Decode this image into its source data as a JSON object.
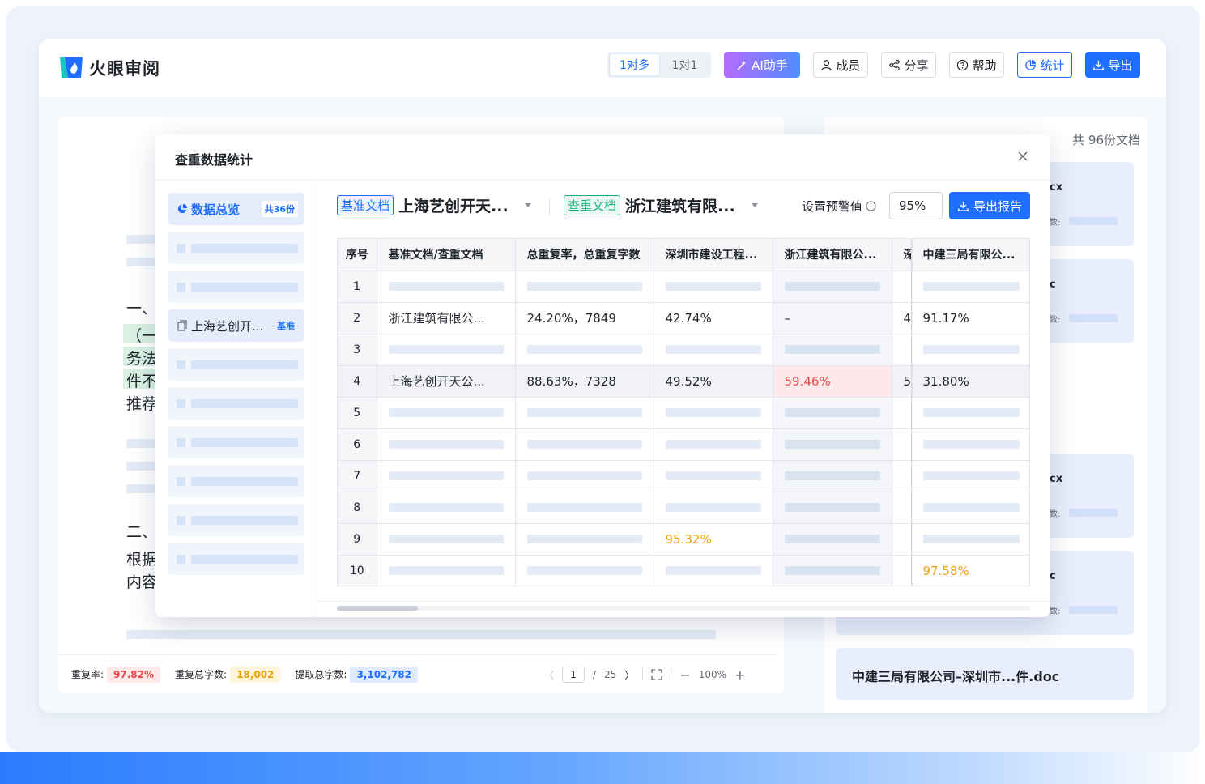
{
  "app": {
    "logo_text": "火眼审阅"
  },
  "header": {
    "mode_toggle": [
      "1对多",
      "1对1"
    ],
    "ai_label": "AI助手",
    "members_label": "成员",
    "share_label": "分享",
    "help_label": "帮助",
    "stats_label": "统计",
    "export_label": "导出"
  },
  "doc": {
    "section1": "一、",
    "para1_lines": [
      "（一",
      "务法",
      "件不",
      "推荐"
    ],
    "section2": "二、",
    "para2_lines": [
      "根据",
      "内容"
    ]
  },
  "footer": {
    "rate_label": "重复率:",
    "rate_value": "97.82%",
    "dup_label": "重复总字数:",
    "dup_value": "18,002",
    "total_label": "提取总字数:",
    "total_value": "3,102,782",
    "page_current": "1",
    "page_sep": "/",
    "page_total": "25",
    "zoom": "100%"
  },
  "right_panel": {
    "count_text": "共 96份文档",
    "card_suffix": "cx",
    "card_sub": "数:",
    "card_suffix_b": "c",
    "last_card_title": "中建三局有限公司–深圳市...件.doc"
  },
  "modal": {
    "title": "查重数据统计",
    "sidebar": {
      "overview_label": "数据总览",
      "overview_badge": "共36份",
      "doc_label": "上海艺创开...",
      "doc_badge": "基准"
    },
    "base_tag": "基准文档",
    "base_name": "上海艺创开天...",
    "cmp_tag": "查重文档",
    "cmp_name": "浙江建筑有限...",
    "warn_label": "设置预警值",
    "warn_value": "95%",
    "report_btn": "导出报告",
    "table": {
      "headers": [
        "序号",
        "基准文档/查重文档",
        "总重复率，总重复字数",
        "深圳市建设工程...",
        "浙江建筑有限公...",
        "深",
        "中建三局有限公..."
      ],
      "rows": [
        {
          "idx": "1"
        },
        {
          "idx": "2",
          "name": "浙江建筑有限公...",
          "total": "24.20%，7849",
          "c1": "42.74%",
          "c2": "–",
          "c3": "4",
          "c4": "91.17%"
        },
        {
          "idx": "3"
        },
        {
          "idx": "4",
          "name": "上海艺创开天公...",
          "total": "88.63%，7328",
          "c1": "49.52%",
          "c2": "59.46%",
          "c3": "5",
          "c4": "31.80%"
        },
        {
          "idx": "5"
        },
        {
          "idx": "6"
        },
        {
          "idx": "7"
        },
        {
          "idx": "8"
        },
        {
          "idx": "9",
          "c1": "95.32%"
        },
        {
          "idx": "10",
          "c4": "97.58%"
        }
      ]
    }
  },
  "colors": {
    "accent": "#1e6fff",
    "danger": "#f2474d",
    "warning": "#f2a30f",
    "success": "#1ab07a"
  }
}
